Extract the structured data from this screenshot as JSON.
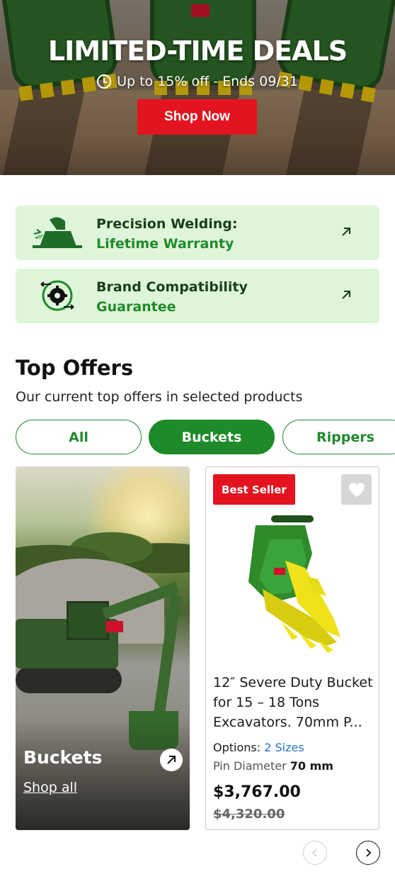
{
  "hero": {
    "title": "LIMITED-TIME DEALS",
    "subtitle": "Up to 15% off - Ends 09/31",
    "cta": "Shop Now",
    "clock_icon": "clock-icon",
    "brand_badge": "JMA"
  },
  "features": [
    {
      "line1": "Precision Welding:",
      "line2": "Lifetime Warranty",
      "icon": "welder-icon"
    },
    {
      "line1": "Brand Compatibility",
      "line2": "Guarantee",
      "icon": "gear-compatibility-icon"
    }
  ],
  "offers": {
    "title": "Top Offers",
    "subtitle": "Our current top offers in selected products",
    "chips": [
      "All",
      "Buckets",
      "Rippers"
    ],
    "active_chip": "Buckets"
  },
  "promo": {
    "label": "Buckets",
    "link": "Shop all",
    "brand_badge": "JMA"
  },
  "product": {
    "badge": "Best Seller",
    "title": "12″ Severe Duty Bucket for 15 – 18 Tons Excavators. 70mm P...",
    "options_label": "Options:",
    "options_value": "2 Sizes",
    "pin_label": "Pin Diameter",
    "pin_value": "70 mm",
    "price": "$3,767.00",
    "old_price": "$4,320.00",
    "brand_badge": "JMA"
  },
  "colors": {
    "brand_green": "#1f8a2a",
    "feature_bg": "#dff5da",
    "cta_red": "#e3141f",
    "link_blue": "#2b72c4"
  }
}
